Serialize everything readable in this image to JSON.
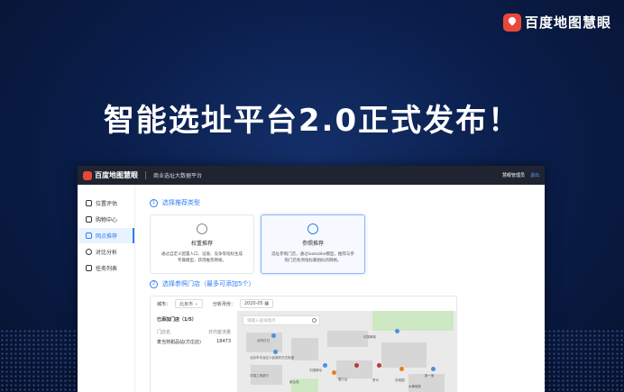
{
  "brand": {
    "name": "百度地图慧眼"
  },
  "headline": "智能选址平台2.0正式发布！",
  "app": {
    "brand": "百度地图慧眼",
    "title": "商业选址大数据平台",
    "user": "慧眼管理员",
    "logout": "退出"
  },
  "sidebar": {
    "items": [
      {
        "label": "位置评估",
        "icon": "location-pin-icon"
      },
      {
        "label": "购物中心",
        "icon": "building-icon"
      },
      {
        "label": "网点推荐",
        "icon": "document-icon"
      },
      {
        "label": "对比分析",
        "icon": "clock-icon"
      },
      {
        "label": "任务列表",
        "icon": "list-icon"
      }
    ],
    "active_index": 2
  },
  "step1": {
    "num": "1",
    "label": "选择推荐类型"
  },
  "cards": [
    {
      "title": "权重推荐",
      "desc": "通过自定义配置人口、设施、竞争等指标生成专属模型，获得推荐网格。",
      "icon": "weight-icon"
    },
    {
      "title": "参照推荐",
      "desc": "选址参照门店，通过lookalike模型，推荐与参照门店各项指标最相似的网格。",
      "icon": "target-icon"
    }
  ],
  "step2": {
    "num": "2",
    "label": "选择参照门店（最多可添加5个）"
  },
  "filters": {
    "city_label": "城市：",
    "city_value": "北京市",
    "month_label": "分析月份：",
    "month_value": "2020-05"
  },
  "store_list": {
    "header": "已添加门店（1/5）",
    "columns": [
      "门店名",
      "日均客流量"
    ],
    "rows": [
      [
        "麦当劳甜品站(方庄店)",
        "18473"
      ]
    ]
  },
  "map": {
    "search_placeholder": "请输入查询地点",
    "labels": [
      "台阳日日",
      "北京市丰台区人民政府方庄街道",
      "中国工商银行",
      "中国移动",
      "中国邮政",
      "壹方店",
      "紫台苑",
      "罗马",
      "芳城园",
      "新一家",
      "木桶城苑"
    ]
  },
  "colors": {
    "accent": "#2f7df6",
    "brand_red": "#e8483a"
  }
}
